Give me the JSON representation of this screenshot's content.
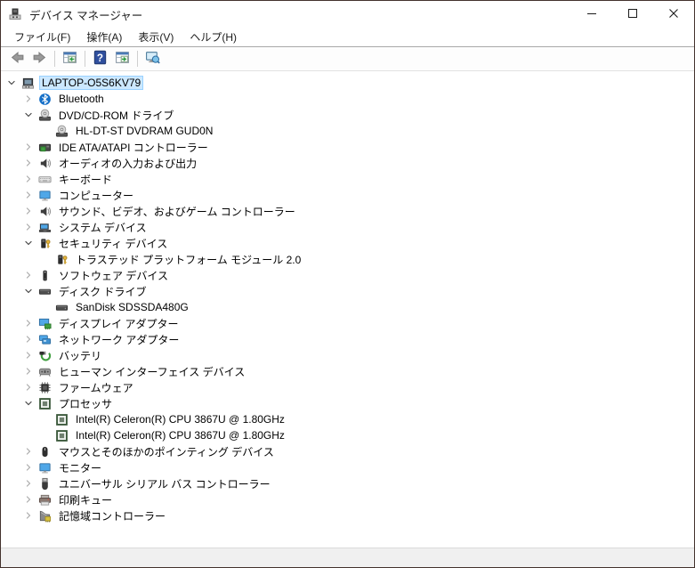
{
  "window": {
    "title": "デバイス マネージャー",
    "app_icon": "device-manager-icon",
    "controls": [
      {
        "name": "minimize-button",
        "icon": "minimize-icon"
      },
      {
        "name": "maximize-button",
        "icon": "maximize-icon"
      },
      {
        "name": "close-button",
        "icon": "close-icon"
      }
    ]
  },
  "menubar": {
    "items": [
      {
        "name": "menu-file",
        "label": "ファイル(F)"
      },
      {
        "name": "menu-action",
        "label": "操作(A)"
      },
      {
        "name": "menu-view",
        "label": "表示(V)"
      },
      {
        "name": "menu-help",
        "label": "ヘルプ(H)"
      }
    ]
  },
  "toolbar": {
    "buttons": [
      {
        "name": "back-button",
        "icon": "back-arrow-icon"
      },
      {
        "name": "forward-button",
        "icon": "forward-arrow-icon"
      },
      {
        "separator": true
      },
      {
        "name": "show-console-tree-button",
        "icon": "console-tree-icon"
      },
      {
        "separator": true
      },
      {
        "name": "help-button",
        "icon": "help-icon"
      },
      {
        "name": "action-pane-button",
        "icon": "action-pane-icon"
      },
      {
        "separator": true
      },
      {
        "name": "scan-hardware-button",
        "icon": "scan-hardware-icon"
      }
    ]
  },
  "tree": {
    "items": [
      {
        "label": "LAPTOP-O5S6KV79",
        "icon": "computer-icon",
        "level": 0,
        "state": "expanded",
        "selected": true
      },
      {
        "label": "Bluetooth",
        "icon": "bluetooth-icon",
        "level": 1,
        "state": "collapsed"
      },
      {
        "label": "DVD/CD-ROM ドライブ",
        "icon": "dvd-icon",
        "level": 1,
        "state": "expanded"
      },
      {
        "label": "HL-DT-ST DVDRAM GUD0N",
        "icon": "dvd-icon",
        "level": 2,
        "state": "none"
      },
      {
        "label": "IDE ATA/ATAPI コントローラー",
        "icon": "ide-icon",
        "level": 1,
        "state": "collapsed"
      },
      {
        "label": "オーディオの入力および出力",
        "icon": "audio-icon",
        "level": 1,
        "state": "collapsed"
      },
      {
        "label": "キーボード",
        "icon": "keyboard-icon",
        "level": 1,
        "state": "collapsed"
      },
      {
        "label": "コンピューター",
        "icon": "monitor-icon",
        "level": 1,
        "state": "collapsed"
      },
      {
        "label": "サウンド、ビデオ、およびゲーム コントローラー",
        "icon": "audio-icon",
        "level": 1,
        "state": "collapsed"
      },
      {
        "label": "システム デバイス",
        "icon": "system-icon",
        "level": 1,
        "state": "collapsed"
      },
      {
        "label": "セキュリティ デバイス",
        "icon": "security-icon",
        "level": 1,
        "state": "expanded"
      },
      {
        "label": "トラステッド プラットフォーム モジュール 2.0",
        "icon": "security-icon",
        "level": 2,
        "state": "none"
      },
      {
        "label": "ソフトウェア デバイス",
        "icon": "software-icon",
        "level": 1,
        "state": "collapsed"
      },
      {
        "label": "ディスク ドライブ",
        "icon": "disk-icon",
        "level": 1,
        "state": "expanded"
      },
      {
        "label": "SanDisk SDSSDA480G",
        "icon": "disk-icon",
        "level": 2,
        "state": "none"
      },
      {
        "label": "ディスプレイ アダプター",
        "icon": "display-adapter-icon",
        "level": 1,
        "state": "collapsed"
      },
      {
        "label": "ネットワーク アダプター",
        "icon": "network-icon",
        "level": 1,
        "state": "collapsed"
      },
      {
        "label": "バッテリ",
        "icon": "battery-icon",
        "level": 1,
        "state": "collapsed"
      },
      {
        "label": "ヒューマン インターフェイス デバイス",
        "icon": "hid-icon",
        "level": 1,
        "state": "collapsed"
      },
      {
        "label": "ファームウェア",
        "icon": "firmware-icon",
        "level": 1,
        "state": "collapsed"
      },
      {
        "label": "プロセッサ",
        "icon": "cpu-icon",
        "level": 1,
        "state": "expanded"
      },
      {
        "label": "Intel(R) Celeron(R) CPU 3867U @ 1.80GHz",
        "icon": "cpu-icon",
        "level": 2,
        "state": "none"
      },
      {
        "label": "Intel(R) Celeron(R) CPU 3867U @ 1.80GHz",
        "icon": "cpu-icon",
        "level": 2,
        "state": "none"
      },
      {
        "label": "マウスとそのほかのポインティング デバイス",
        "icon": "mouse-icon",
        "level": 1,
        "state": "collapsed"
      },
      {
        "label": "モニター",
        "icon": "monitor-icon",
        "level": 1,
        "state": "collapsed"
      },
      {
        "label": "ユニバーサル シリアル バス コントローラー",
        "icon": "usb-icon",
        "level": 1,
        "state": "collapsed"
      },
      {
        "label": "印刷キュー",
        "icon": "printer-icon",
        "level": 1,
        "state": "collapsed"
      },
      {
        "label": "記憶域コントローラー",
        "icon": "storage-icon",
        "level": 1,
        "state": "collapsed"
      }
    ]
  },
  "colors": {
    "selection_bg": "#cce8ff",
    "selection_border": "#99d1ff",
    "window_border": "#43322d"
  }
}
